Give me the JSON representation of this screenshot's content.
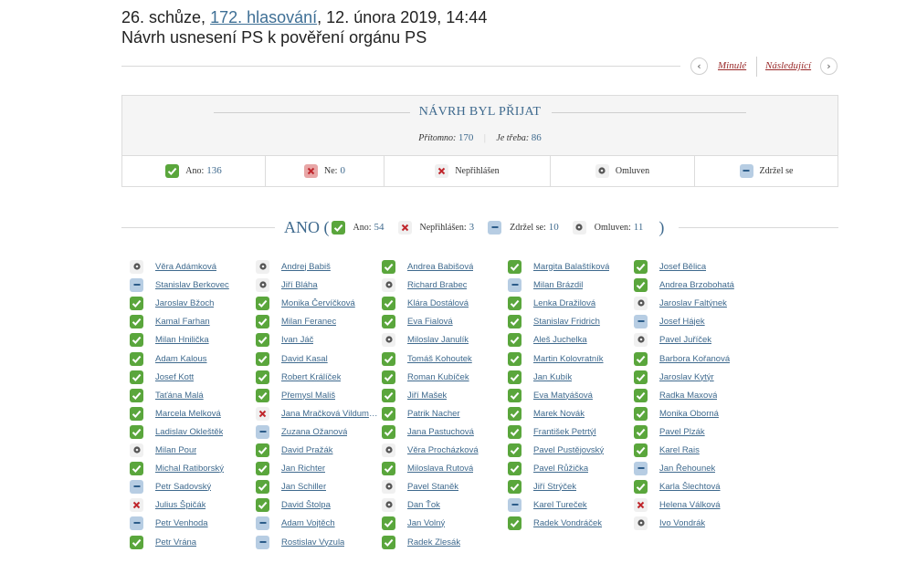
{
  "header": {
    "title_prefix": "26. schůze,",
    "title_link": "172. hlasování",
    "title_suffix": ", 12. února 2019, 14:44",
    "subtitle": "Návrh usnesení PS k pověření orgánu PS"
  },
  "nav": {
    "prev_label": "Minulé",
    "next_label": "Následující",
    "prev_icon": "‹",
    "next_icon": "›"
  },
  "result": {
    "title": "NÁVRH BYL PŘIJAT",
    "present_label": "Přítomno:",
    "present_value": "170",
    "stats_separator": "|",
    "required_label": "Je třeba:",
    "required_value": "86",
    "tally": [
      {
        "status": "ano",
        "label": "Ano:",
        "value": "136"
      },
      {
        "status": "ne",
        "label": "Ne:",
        "value": "0"
      },
      {
        "status": "nep",
        "label": "Nepřihlášen",
        "value": ""
      },
      {
        "status": "oml",
        "label": "Omluven",
        "value": ""
      },
      {
        "status": "zdr",
        "label": "Zdržel se",
        "value": ""
      }
    ]
  },
  "filter": {
    "title": "ANO (",
    "close": ")",
    "items": [
      {
        "status": "ano",
        "label": "Ano:",
        "value": "54"
      },
      {
        "status": "nep",
        "label": "Nepřihlášen:",
        "value": "3"
      },
      {
        "status": "zdr",
        "label": "Zdržel se:",
        "value": "10"
      },
      {
        "status": "oml",
        "label": "Omluven:",
        "value": "11"
      }
    ]
  },
  "colors": {
    "ano": "#5aa63c",
    "ne": "#e8a6a6",
    "zdrzel": "#b7cde3",
    "link": "#3f6a8e",
    "nav_link": "#9a2a2a"
  },
  "mps": [
    [
      {
        "name": "Věra Adámková",
        "status": "oml"
      },
      {
        "name": "Stanislav Berkovec",
        "status": "zdr"
      },
      {
        "name": "Jaroslav Bžoch",
        "status": "ano"
      },
      {
        "name": "Kamal Farhan",
        "status": "ano"
      },
      {
        "name": "Milan Hnilička",
        "status": "ano"
      },
      {
        "name": "Adam Kalous",
        "status": "ano"
      },
      {
        "name": "Josef Kott",
        "status": "ano"
      },
      {
        "name": "Taťána Malá",
        "status": "ano"
      },
      {
        "name": "Marcela Melková",
        "status": "ano"
      },
      {
        "name": "Ladislav Okleštěk",
        "status": "ano"
      },
      {
        "name": "Milan Pour",
        "status": "oml"
      },
      {
        "name": "Michal Ratiborský",
        "status": "ano"
      },
      {
        "name": "Petr Sadovský",
        "status": "zdr"
      },
      {
        "name": "Julius Špičák",
        "status": "nep"
      },
      {
        "name": "Petr Venhoda",
        "status": "zdr"
      },
      {
        "name": "Petr Vrána",
        "status": "ano"
      }
    ],
    [
      {
        "name": "Andrej Babiš",
        "status": "oml"
      },
      {
        "name": "Jiří Bláha",
        "status": "oml"
      },
      {
        "name": "Monika Červíčková",
        "status": "ano"
      },
      {
        "name": "Milan Feranec",
        "status": "ano"
      },
      {
        "name": "Ivan Jáč",
        "status": "ano"
      },
      {
        "name": "David Kasal",
        "status": "ano"
      },
      {
        "name": "Robert Králíček",
        "status": "ano"
      },
      {
        "name": "Přemysl Mališ",
        "status": "ano"
      },
      {
        "name": "Jana Mračková Vildumetzová",
        "status": "nep"
      },
      {
        "name": "Zuzana Ožanová",
        "status": "zdr"
      },
      {
        "name": "David Pražák",
        "status": "ano"
      },
      {
        "name": "Jan Richter",
        "status": "ano"
      },
      {
        "name": "Jan Schiller",
        "status": "ano"
      },
      {
        "name": "David Štolpa",
        "status": "ano"
      },
      {
        "name": "Adam Vojtěch",
        "status": "zdr"
      },
      {
        "name": "Rostislav Vyzula",
        "status": "zdr"
      }
    ],
    [
      {
        "name": "Andrea Babišová",
        "status": "ano"
      },
      {
        "name": "Richard Brabec",
        "status": "oml"
      },
      {
        "name": "Klára Dostálová",
        "status": "ano"
      },
      {
        "name": "Eva Fialová",
        "status": "ano"
      },
      {
        "name": "Miloslav Janulík",
        "status": "oml"
      },
      {
        "name": "Tomáš Kohoutek",
        "status": "ano"
      },
      {
        "name": "Roman Kubíček",
        "status": "ano"
      },
      {
        "name": "Jiří Mašek",
        "status": "ano"
      },
      {
        "name": "Patrik Nacher",
        "status": "ano"
      },
      {
        "name": "Jana Pastuchová",
        "status": "ano"
      },
      {
        "name": "Věra Procházková",
        "status": "oml"
      },
      {
        "name": "Miloslava Rutová",
        "status": "ano"
      },
      {
        "name": "Pavel Staněk",
        "status": "oml"
      },
      {
        "name": "Dan Ťok",
        "status": "oml"
      },
      {
        "name": "Jan Volný",
        "status": "ano"
      },
      {
        "name": "Radek Zlesák",
        "status": "ano"
      }
    ],
    [
      {
        "name": "Margita Balaštíková",
        "status": "ano"
      },
      {
        "name": "Milan Brázdil",
        "status": "zdr"
      },
      {
        "name": "Lenka Dražilová",
        "status": "ano"
      },
      {
        "name": "Stanislav Fridrich",
        "status": "ano"
      },
      {
        "name": "Aleš Juchelka",
        "status": "ano"
      },
      {
        "name": "Martin Kolovratník",
        "status": "ano"
      },
      {
        "name": "Jan Kubík",
        "status": "ano"
      },
      {
        "name": "Eva Matyášová",
        "status": "ano"
      },
      {
        "name": "Marek Novák",
        "status": "ano"
      },
      {
        "name": "František Petrtýl",
        "status": "ano"
      },
      {
        "name": "Pavel Pustějovský",
        "status": "ano"
      },
      {
        "name": "Pavel Růžička",
        "status": "ano"
      },
      {
        "name": "Jiří Strýček",
        "status": "ano"
      },
      {
        "name": "Karel Tureček",
        "status": "zdr"
      },
      {
        "name": "Radek Vondráček",
        "status": "ano"
      }
    ],
    [
      {
        "name": "Josef Bělica",
        "status": "ano"
      },
      {
        "name": "Andrea Brzobohatá",
        "status": "ano"
      },
      {
        "name": "Jaroslav Faltýnek",
        "status": "oml"
      },
      {
        "name": "Josef Hájek",
        "status": "zdr"
      },
      {
        "name": "Pavel Juříček",
        "status": "oml"
      },
      {
        "name": "Barbora Kořanová",
        "status": "ano"
      },
      {
        "name": "Jaroslav Kytýr",
        "status": "ano"
      },
      {
        "name": "Radka Maxová",
        "status": "ano"
      },
      {
        "name": "Monika Oborná",
        "status": "ano"
      },
      {
        "name": "Pavel Plzák",
        "status": "ano"
      },
      {
        "name": "Karel Rais",
        "status": "ano"
      },
      {
        "name": "Jan Řehounek",
        "status": "zdr"
      },
      {
        "name": "Karla Šlechtová",
        "status": "ano"
      },
      {
        "name": "Helena Válková",
        "status": "nep"
      },
      {
        "name": "Ivo Vondrák",
        "status": "oml"
      }
    ]
  ]
}
